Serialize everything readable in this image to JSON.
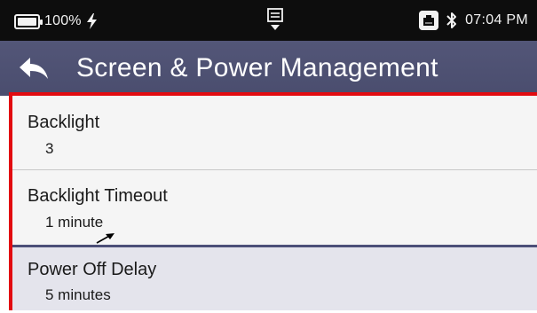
{
  "status_bar": {
    "battery_percent": "100%",
    "battery_icon": "battery-full-icon",
    "charging_icon": "lightning-bolt-icon",
    "center_icon": "notification-tray-icon",
    "ethernet_icon": "ethernet-port-icon",
    "bluetooth_icon": "bluetooth-icon",
    "time": "07:04 PM"
  },
  "header": {
    "back_icon": "back-arrow-icon",
    "title": "Screen & Power Management"
  },
  "settings": [
    {
      "label": "Backlight",
      "value": "3"
    },
    {
      "label": "Backlight Timeout",
      "value": "1 minute"
    },
    {
      "label": "Power Off Delay",
      "value": "5 minutes"
    }
  ],
  "colors": {
    "header_bg": "#4f5274",
    "status_bg": "#0d0d0d",
    "highlight_border": "#e20b10",
    "separator_accent": "#4c4f78",
    "selected_row_bg": "#e4e4ec"
  }
}
